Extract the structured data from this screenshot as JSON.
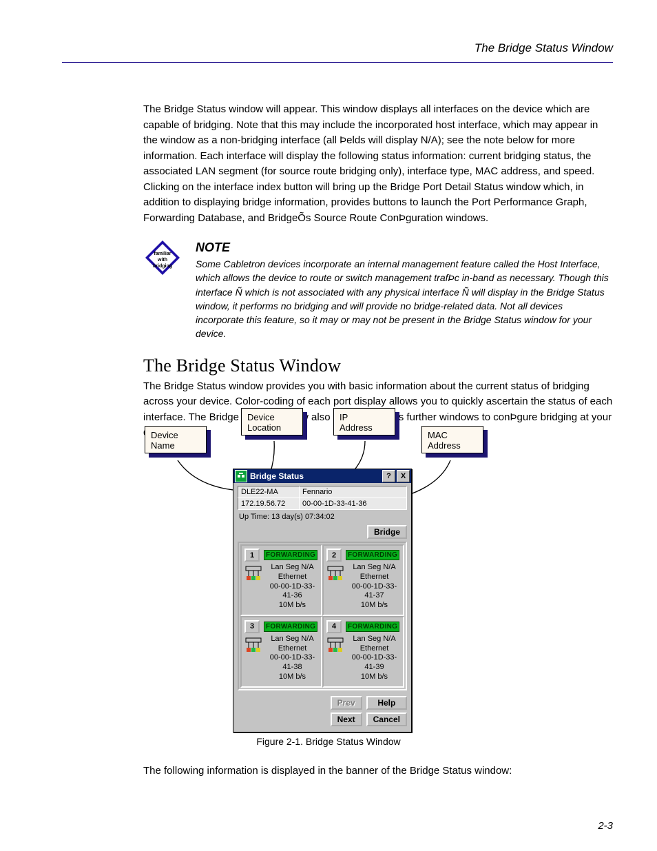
{
  "header": {
    "right": "The Bridge Status Window",
    "page_num": "2-3"
  },
  "para1": "The Bridge Status window will appear. This window displays all interfaces on the device which are capable of bridging. Note that this may include the incorporated host interface, which may appear in the window as a non-bridging interface (all Þelds will display N/A); see the note below for more information. Each interface will display the following status information: current bridging status, the associated LAN segment (for source route bridging only), interface type, MAC address, and speed. Clicking on the interface index button will bring up the Bridge Port Detail Status window which, in addition to displaying bridge information, provides buttons to launch the Port Performance Graph, Forwarding Database, and BridgeÕs Source Route ConÞguration windows.",
  "note": {
    "heading": "NOTE",
    "text": "Some Cabletron devices incorporate an internal management feature called the Host Interface, which allows the device to route or switch management trafÞc in-band as necessary. Though this interface Ñ which is not associated with any physical interface Ñ will display in the Bridge Status window, it performs no bridging and will provide no bridge-related data. Not all devices incorporate this feature, so it may or may not be present in the Bridge Status window for your device."
  },
  "h2": "The Bridge Status Window",
  "para2": "The Bridge Status window provides you with basic information about the current status of bridging across your device. Color-coding of each port display allows you to quickly ascertain the status of each interface. The Bridge Status window also lets you access further windows to conÞgure bridging at your device.",
  "callouts": {
    "device_name": "Device\nName",
    "ip_address": "IP\nAddress",
    "device_location": "Device\nLocation",
    "mac_address": "MAC\nAddress"
  },
  "win": {
    "title": "Bridge Status",
    "help_q": "?",
    "close_x": "X",
    "info": {
      "name": "DLE22-MA",
      "location": "Fennario",
      "ip": "172.19.56.72",
      "mac": "00-00-1D-33-41-36"
    },
    "uptime": "Up Time: 13 day(s) 07:34:02",
    "bridge_btn": "Bridge",
    "fwd_label": "FORWARDING",
    "ports": [
      {
        "n": "1",
        "seg": "Lan Seg N/A",
        "type": "Ethernet",
        "mac": "00-00-1D-33-41-36",
        "spd": "10M b/s"
      },
      {
        "n": "2",
        "seg": "Lan Seg N/A",
        "type": "Ethernet",
        "mac": "00-00-1D-33-41-37",
        "spd": "10M b/s"
      },
      {
        "n": "3",
        "seg": "Lan Seg N/A",
        "type": "Ethernet",
        "mac": "00-00-1D-33-41-38",
        "spd": "10M b/s"
      },
      {
        "n": "4",
        "seg": "Lan Seg N/A",
        "type": "Ethernet",
        "mac": "00-00-1D-33-41-39",
        "spd": "10M b/s"
      }
    ],
    "btns": {
      "prev": "Prev",
      "next": "Next",
      "help": "Help",
      "cancel": "Cancel"
    }
  },
  "caption": "Figure 2-1. Bridge Status Window",
  "below": "The following information is displayed in the banner of the Bridge Status window:"
}
